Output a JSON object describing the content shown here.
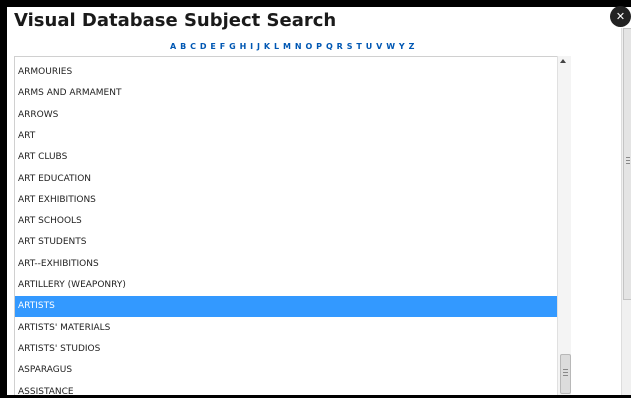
{
  "title": "Visual Database Subject Search",
  "close_label": "✕",
  "alphabet": [
    "A",
    "B",
    "C",
    "D",
    "E",
    "F",
    "G",
    "H",
    "I",
    "J",
    "K",
    "L",
    "M",
    "N",
    "O",
    "P",
    "Q",
    "R",
    "S",
    "T",
    "U",
    "V",
    "W",
    "Y",
    "Z"
  ],
  "subjects": [
    "ARMOURIES",
    "ARMS AND ARMAMENT",
    "ARROWS",
    "ART",
    "ART CLUBS",
    "ART EDUCATION",
    "ART EXHIBITIONS",
    "ART SCHOOLS",
    "ART STUDENTS",
    "ART--EXHIBITIONS",
    "ARTILLERY (WEAPONRY)",
    "ARTISTS",
    "ARTISTS' MATERIALS",
    "ARTISTS' STUDIOS",
    "ASPARAGUS",
    "ASSISTANCE"
  ],
  "selected_subject": "ARTISTS",
  "colors": {
    "selection": "#3399ff",
    "link": "#0057b3"
  }
}
